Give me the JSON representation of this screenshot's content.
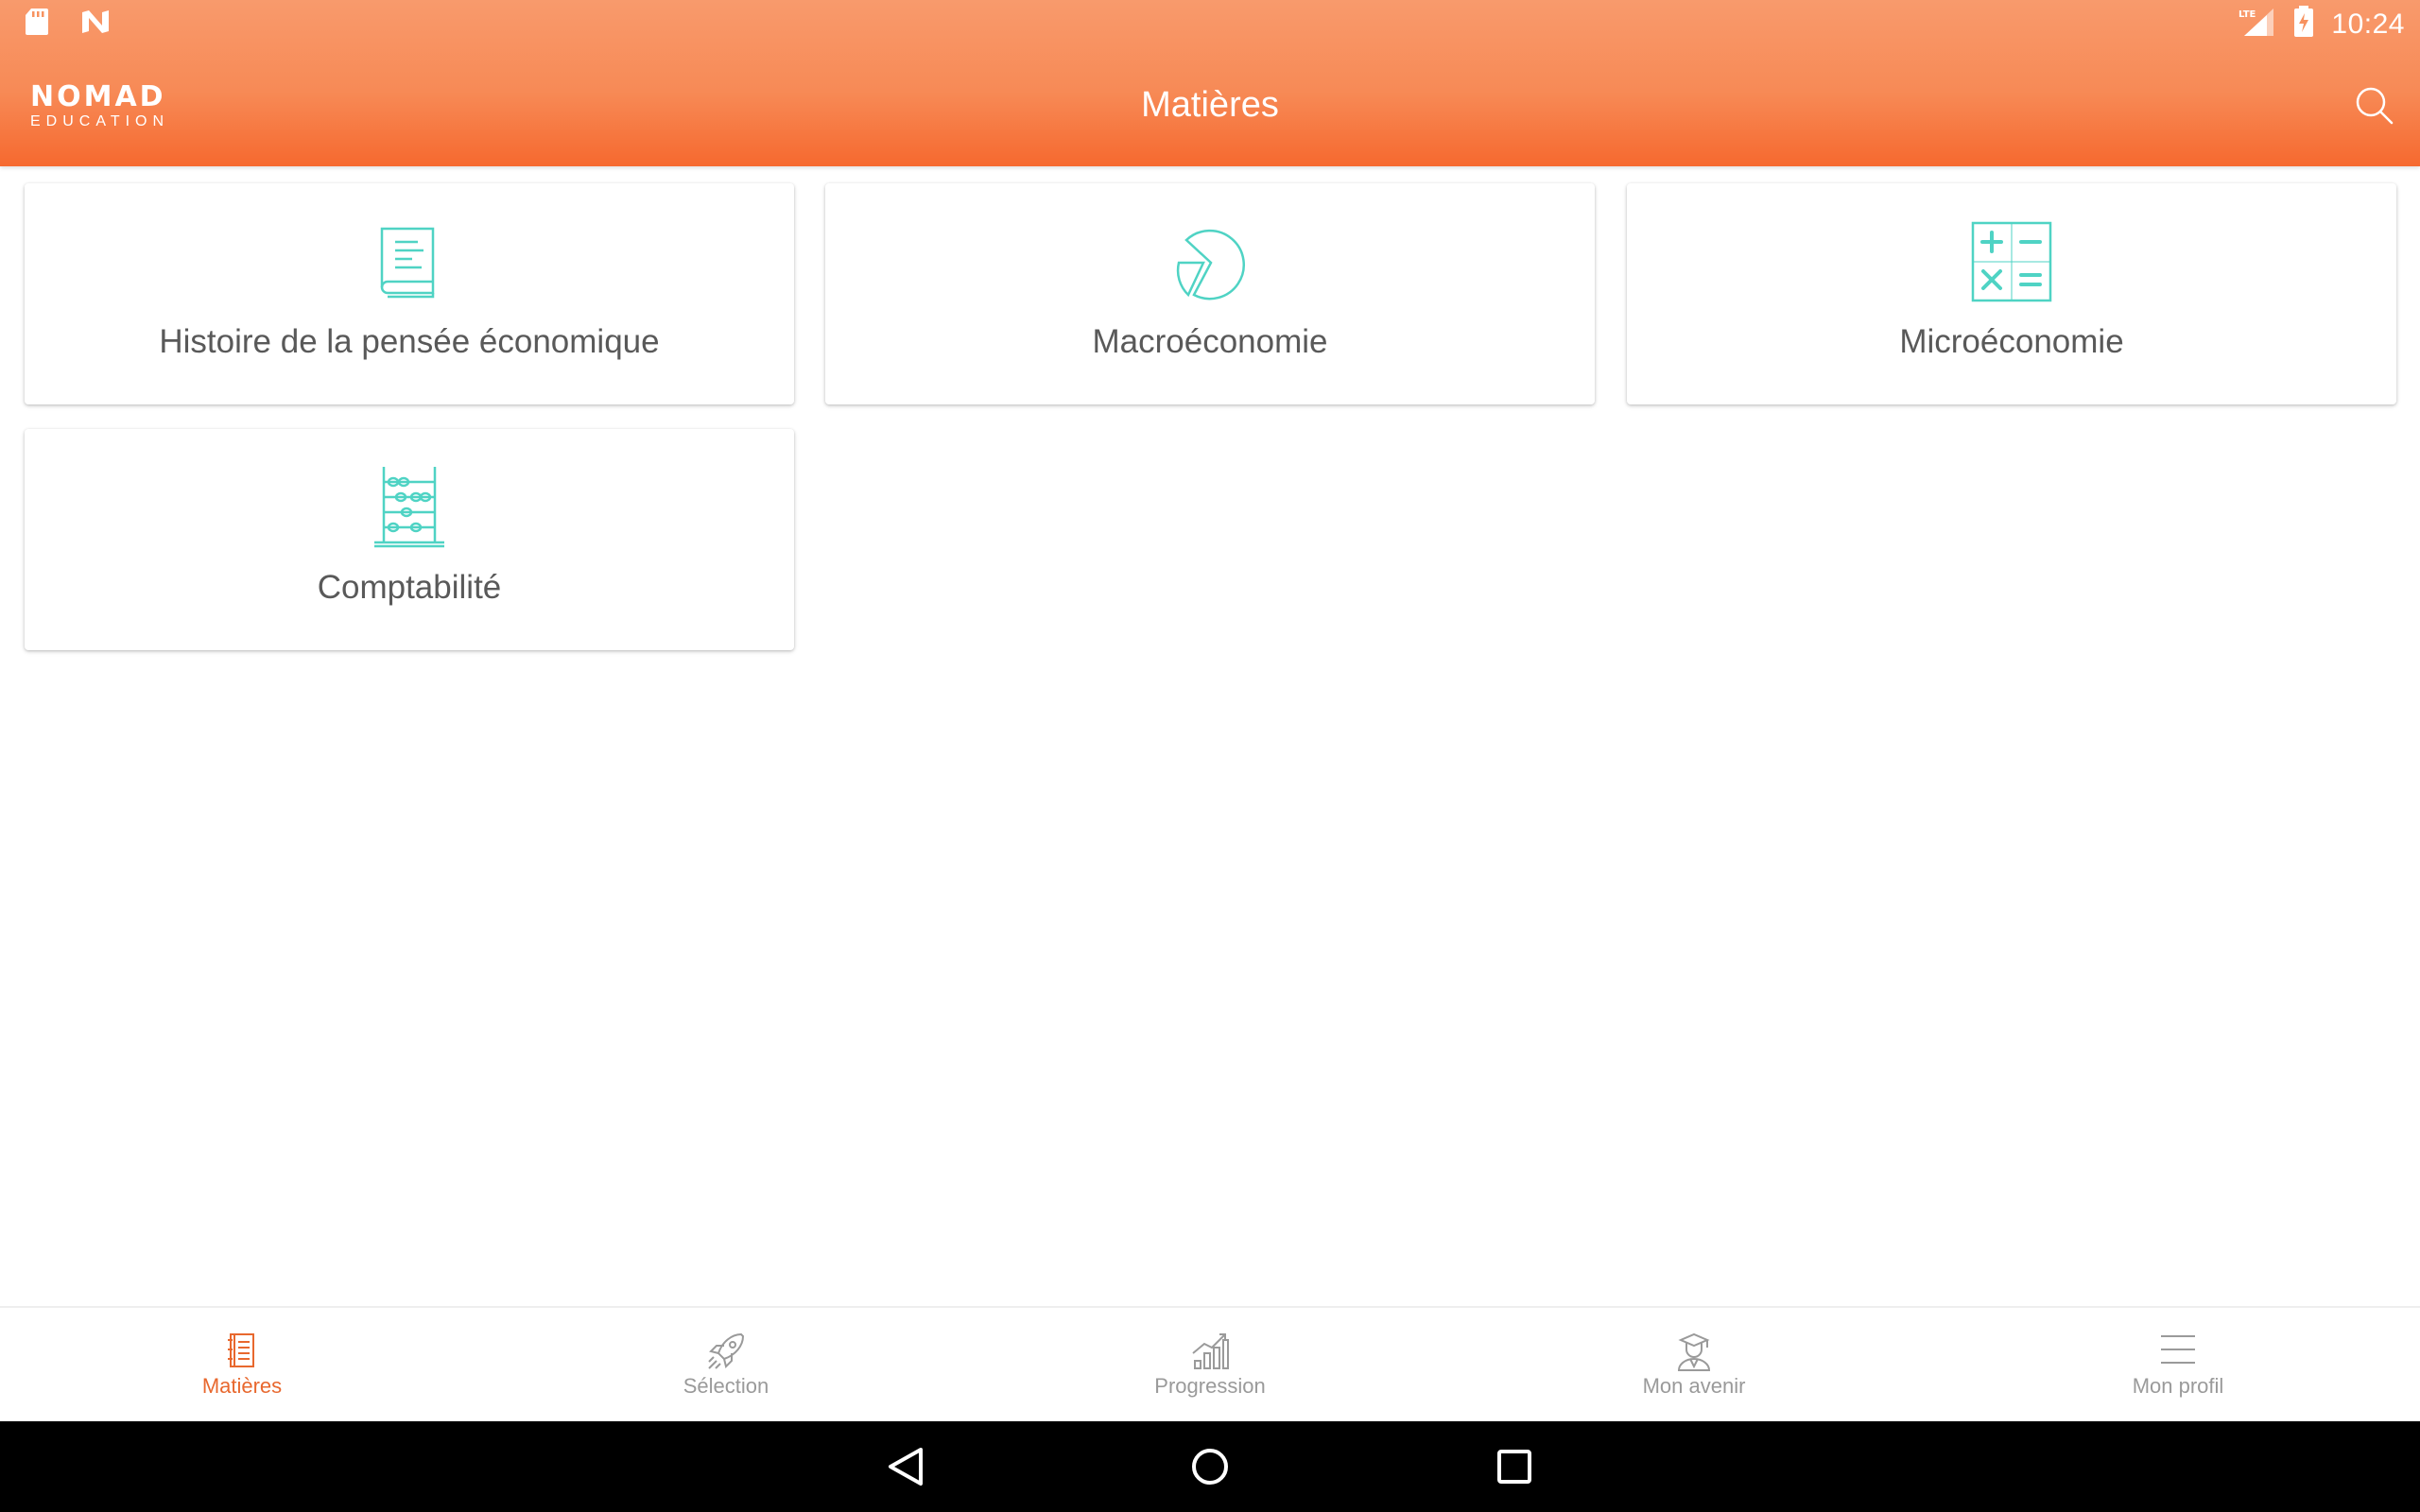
{
  "status_bar": {
    "left_icons": [
      "sd-card-icon",
      "n-notification-icon"
    ],
    "network": "LTE",
    "time": "10:24"
  },
  "app_bar": {
    "logo_main": "NOMAD",
    "logo_sub": "EDUCATION",
    "title": "Matières",
    "search_icon": "search-icon"
  },
  "subjects": [
    {
      "label": "Histoire de la pensée économique",
      "icon": "book-icon"
    },
    {
      "label": "Macroéconomie",
      "icon": "pie-chart-icon"
    },
    {
      "label": "Microéconomie",
      "icon": "calculator-icon"
    },
    {
      "label": "Comptabilité",
      "icon": "abacus-icon"
    }
  ],
  "bottom_nav": {
    "items": [
      {
        "label": "Matières",
        "icon": "notebook-icon",
        "active": true
      },
      {
        "label": "Sélection",
        "icon": "rocket-icon",
        "active": false
      },
      {
        "label": "Progression",
        "icon": "bar-chart-icon",
        "active": false
      },
      {
        "label": "Mon avenir",
        "icon": "graduate-icon",
        "active": false
      },
      {
        "label": "Mon profil",
        "icon": "menu-icon",
        "active": false
      }
    ]
  },
  "colors": {
    "header_top": "#f89a6c",
    "header_bottom": "#f6692f",
    "icon_teal": "#4fd3c4",
    "active_nav": "#e8682e",
    "inactive_nav": "#9a9a9a"
  }
}
